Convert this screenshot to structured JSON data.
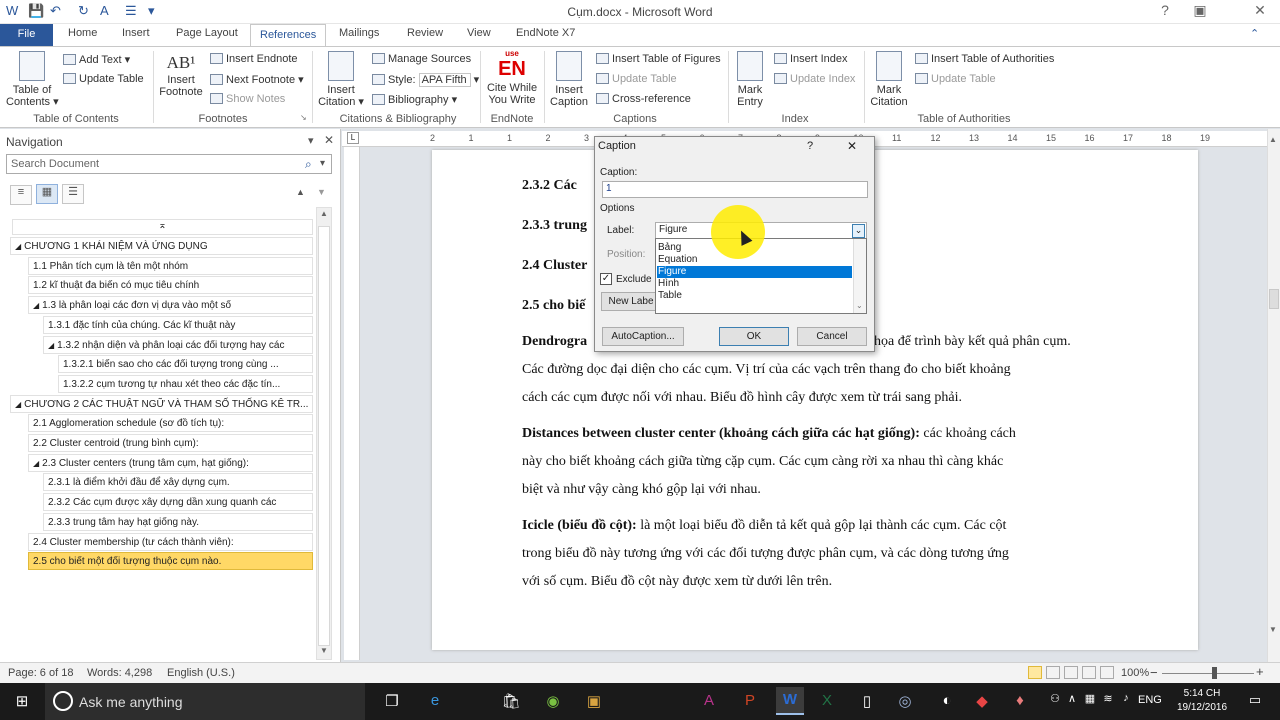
{
  "app": {
    "title": "Cụm.docx - Microsoft Word"
  },
  "tabs": [
    "File",
    "Home",
    "Insert",
    "Page Layout",
    "References",
    "Mailings",
    "Review",
    "View",
    "EndNote X7"
  ],
  "ribbon": {
    "toc": {
      "label1": "Table of",
      "label2": "Contents",
      "add_text": "Add Text",
      "update_table": "Update Table",
      "group": "Table of Contents"
    },
    "footnotes": {
      "big1": "Insert",
      "big2": "Footnote",
      "insert_endnote": "Insert Endnote",
      "next_footnote": "Next Footnote",
      "show_notes": "Show Notes",
      "group": "Footnotes"
    },
    "citations": {
      "big1": "Insert",
      "big2": "Citation",
      "manage": "Manage Sources",
      "style_label": "Style:",
      "style_value": "APA Fifth",
      "bibliography": "Bibliography",
      "group": "Citations & Bibliography"
    },
    "endnote": {
      "big1": "Cite While",
      "big2": "You Write",
      "logo_top": "use",
      "logo": "EN",
      "group": "EndNote"
    },
    "captions": {
      "big1": "Insert",
      "big2": "Caption",
      "insert_tof": "Insert Table of Figures",
      "update_table": "Update Table",
      "cross_ref": "Cross-reference",
      "group": "Captions"
    },
    "index": {
      "big1": "Mark",
      "big2": "Entry",
      "insert_index": "Insert Index",
      "update_index": "Update Index",
      "group": "Index"
    },
    "toa": {
      "big1": "Mark",
      "big2": "Citation",
      "insert_toa": "Insert Table of Authorities",
      "update_table": "Update Table",
      "group": "Table of Authorities"
    }
  },
  "nav": {
    "title": "Navigation",
    "search_placeholder": "Search Document",
    "items": [
      {
        "text": "CHƯƠNG 1 KHÁI NIỆM VÀ ỨNG DỤNG"
      },
      {
        "text": "1.1 Phân tích cụm là tên một nhóm"
      },
      {
        "text": "1.2 kĩ thuật đa biến có mục tiêu chính"
      },
      {
        "text": "1.3  là phân loại các đơn vị dựa vào một số"
      },
      {
        "text": "1.3.1 đặc tính của chúng. Các kĩ thuật này"
      },
      {
        "text": "1.3.2  nhận diện và phân loại các đối tượng hay các"
      },
      {
        "text": "1.3.2.1 biến sao cho các đối tượng trong cùng ..."
      },
      {
        "text": "1.3.2.2 cụm tương tự nhau xét theo các đặc tín..."
      },
      {
        "text": "CHƯƠNG 2 CÁC THUẬT NGỮ VÀ THAM SỐ THỐNG KÊ TR..."
      },
      {
        "text": "2.1 Agglomeration schedule (sơ đồ tích tụ):"
      },
      {
        "text": "2.2 Cluster centroid (trung bình cụm):"
      },
      {
        "text": "2.3 Cluster centers (trung tâm cụm, hạt giống):"
      },
      {
        "text": "2.3.1 là điểm khởi đầu để xây dựng cụm."
      },
      {
        "text": "2.3.2  Các cụm được xây dựng dần xung quanh các"
      },
      {
        "text": "2.3.3 trung tâm hay hạt giống này."
      },
      {
        "text": "2.4 Cluster membership (tư cách thành viên):"
      },
      {
        "text": "2.5 cho biết một đối tượng thuộc cụm nào."
      }
    ]
  },
  "doc": {
    "h1": "2.3.2  Các",
    "h2": "2.3.3 trung",
    "h3": "2.4 Cluster",
    "h4": "2.5 cho biế",
    "p1_bold": "Dendrogra",
    "p1a": "họa để trình bày kết quả phân cụm.",
    "p1b": "Các đường dọc đại diện cho các cụm. Vị trí của các vạch trên thang đo cho biết khoảng",
    "p1c": "cách các cụm được nối với nhau. Biểu đồ hình cây được xem từ trái sang phải.",
    "p2_bold": "Distances between cluster center (khoảng cách giữa các hạt giống):",
    "p2a": " các khoảng cách",
    "p2b": "này cho biết khoảng cách giữa từng cặp cụm. Các cụm càng rời xa nhau thì càng khác",
    "p2c": "biệt và như vậy càng khó gộp lại với nhau.",
    "p3_bold": "Icicle (biểu đồ cột):",
    "p3a": " là một loại biểu đồ diễn tả kết quả gộp lại thành các cụm. Các cột",
    "p3b": "trong biểu đồ này tương ứng với các đối tượng được phân cụm, và các dòng tương ứng",
    "p3c": "với số cụm. Biểu đồ cột này được xem từ dưới lên trên."
  },
  "dialog": {
    "title": "Caption",
    "help": "?",
    "close": "✕",
    "caption_label": "Caption:",
    "caption_value": "1",
    "options_label": "Options",
    "label_label": "Label:",
    "label_value": "Figure",
    "position_label": "Position:",
    "exclude_label": "Exclude l",
    "new_label": "New Labe",
    "autocaption": "AutoCaption...",
    "ok": "OK",
    "cancel": "Cancel",
    "options": [
      "Bảng",
      "Equation",
      "Figure",
      "Hình",
      "Table"
    ],
    "selected": "Figure"
  },
  "status": {
    "page": "Page: 6 of 18",
    "words": "Words: 4,298",
    "lang": "English (U.S.)",
    "zoom": "100%"
  },
  "taskbar": {
    "search": "Ask me anything",
    "lang": "ENG",
    "time": "5:14 CH",
    "date": "19/12/2016"
  }
}
